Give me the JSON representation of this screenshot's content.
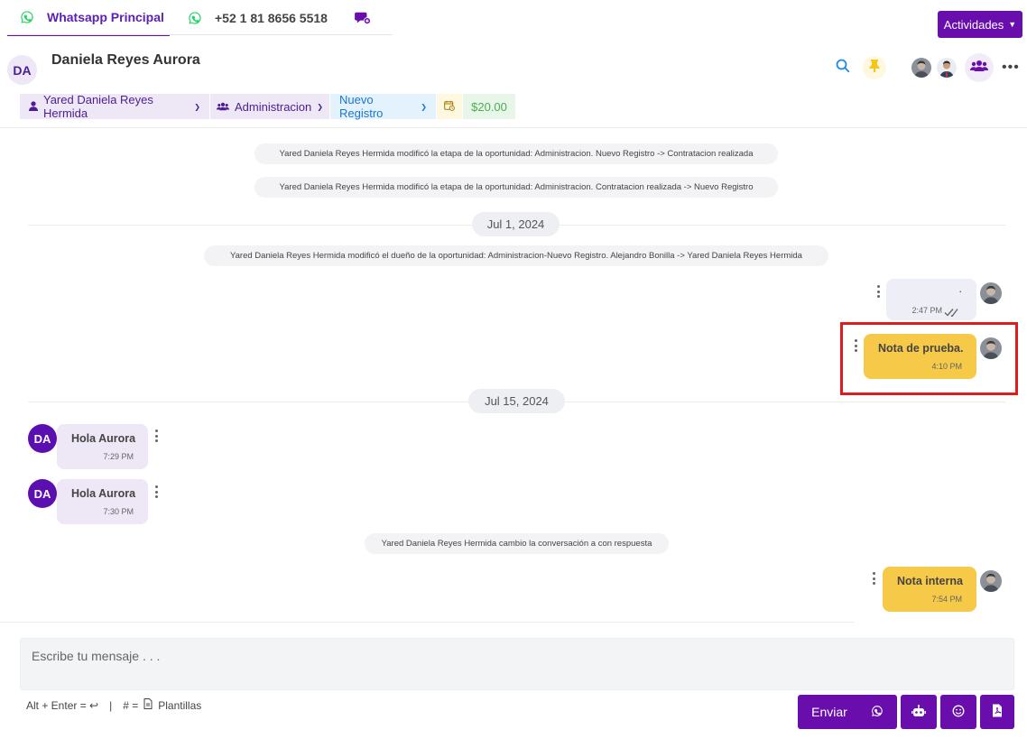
{
  "tabs": [
    {
      "label": "Whatsapp Principal",
      "icon": "whatsapp-icon",
      "active": true
    },
    {
      "label": "+52 1 81 8656 5518",
      "icon": "whatsapp-icon",
      "active": false
    },
    {
      "label": "",
      "icon": "new-chat-icon",
      "active": false
    }
  ],
  "actions": {
    "actividades_label": "Actividades"
  },
  "contact": {
    "initials": "DA",
    "name": "Daniela Reyes Aurora"
  },
  "chips": {
    "owner": "Yared Daniela Reyes Hermida",
    "team": "Administracion",
    "stage": "Nuevo Registro",
    "amount": "$20.00"
  },
  "messages": {
    "sys1": "Yared Daniela Reyes Hermida modificó la etapa de la oportunidad: Administracion. Nuevo Registro -> Contratacion realizada",
    "sys2": "Yared Daniela Reyes Hermida modificó la etapa de la oportunidad: Administracion. Contratacion realizada -> Nuevo Registro",
    "date1": "Jul 1, 2024",
    "sys3": "Yared Daniela Reyes Hermida modificó el dueño de la oportunidad: Administracion-Nuevo Registro. Alejandro Bonilla -> Yared Daniela Reyes Hermida",
    "out1": {
      "text": ".",
      "time": "2:47 PM"
    },
    "note1": {
      "text": "Nota de prueba.",
      "time": "4:10 PM"
    },
    "date2": "Jul 15, 2024",
    "in1": {
      "initials": "DA",
      "text": "Hola Aurora",
      "time": "7:29 PM"
    },
    "in2": {
      "initials": "DA",
      "text": "Hola Aurora",
      "time": "7:30 PM"
    },
    "sys4": "Yared Daniela Reyes Hermida cambio la conversación a con respuesta",
    "note2": {
      "text": "Nota interna",
      "time": "7:54 PM"
    }
  },
  "composer": {
    "placeholder": "Escribe tu mensaje . . .",
    "hint_shortcut": "Alt + Enter = ↩",
    "hint_sep": "|",
    "hint_hash": "# =",
    "hint_templates": "Plantillas",
    "send_label": "Enviar"
  },
  "colors": {
    "brand": "#6a0dad",
    "note": "#f7c948",
    "highlight": "#e01b1b",
    "whatsapp": "#25d366"
  }
}
